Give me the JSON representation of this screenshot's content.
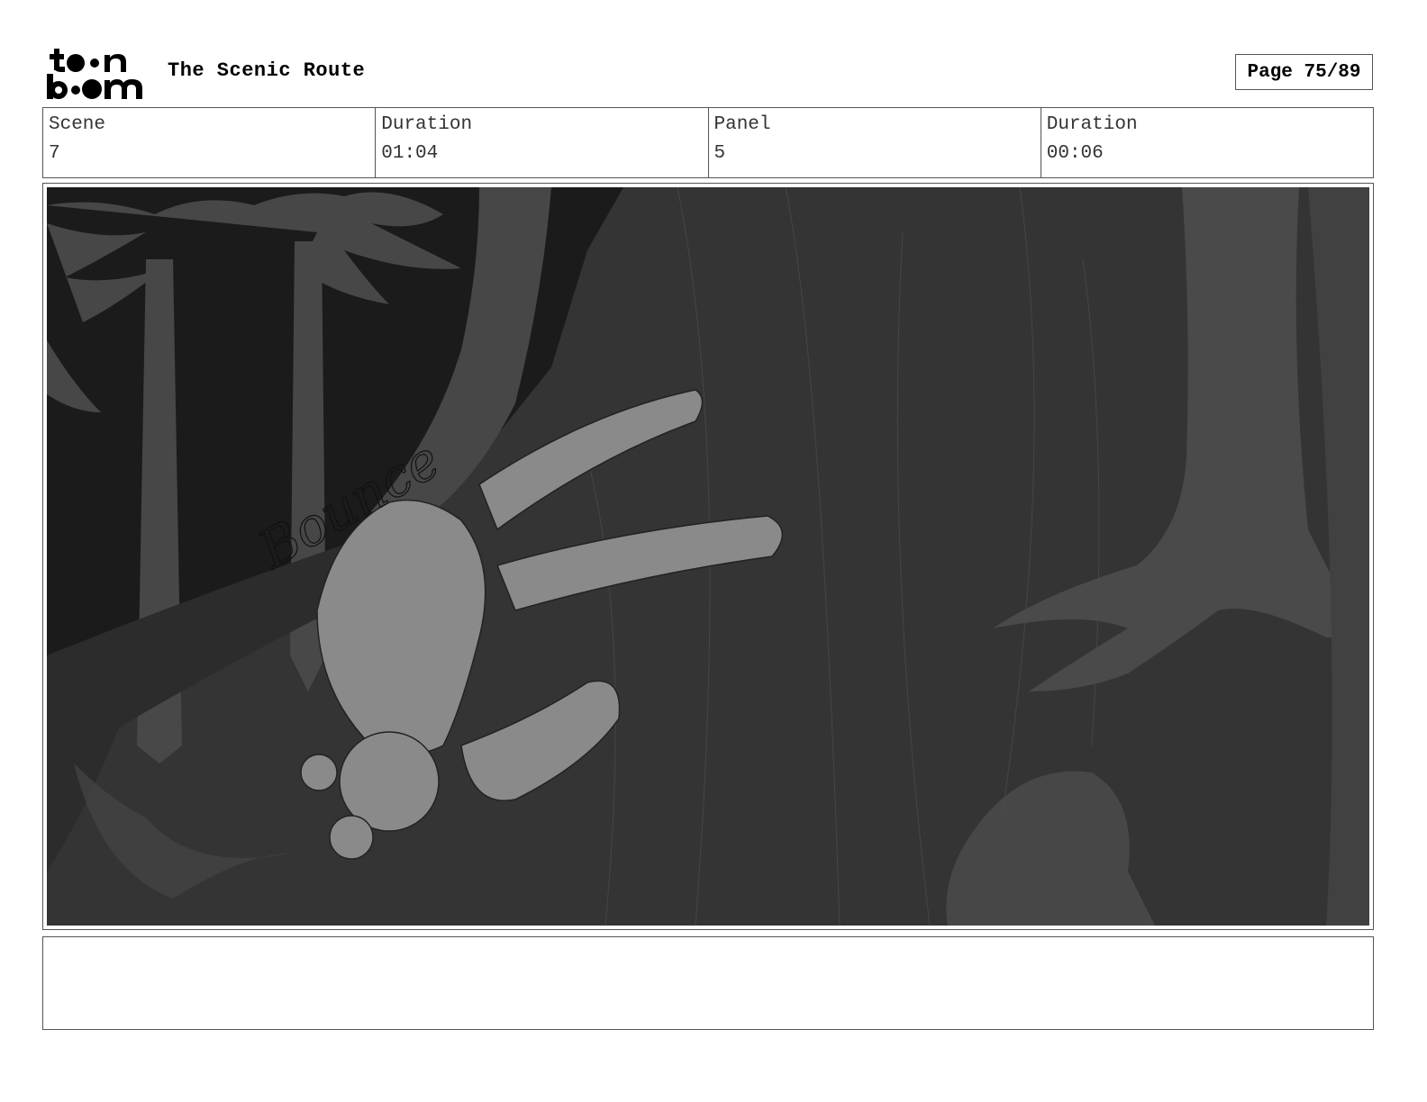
{
  "header": {
    "logo_text": "toon boom",
    "title": "The Scenic Route",
    "page_label": "Page 75/89"
  },
  "info": {
    "scene_label": "Scene",
    "scene_value": "7",
    "scene_duration_label": "Duration",
    "scene_duration_value": "01:04",
    "panel_label": "Panel",
    "panel_value": "5",
    "panel_duration_label": "Duration",
    "panel_duration_value": "00:06"
  },
  "panel": {
    "sketch_text": "Bounce"
  },
  "notes": {
    "text": ""
  }
}
